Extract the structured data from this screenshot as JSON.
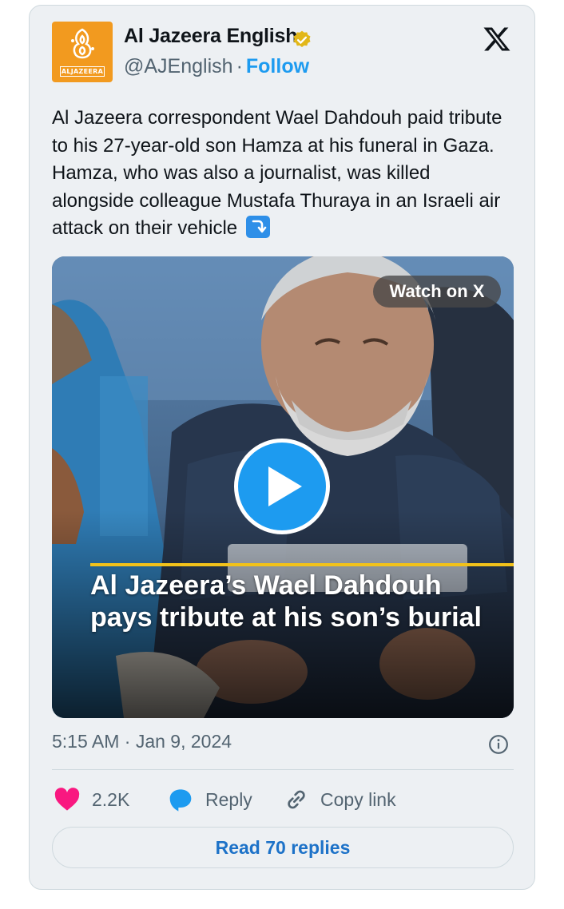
{
  "author": {
    "display_name": "Al Jazeera English",
    "handle": "@AJEnglish",
    "separator": "·",
    "follow_label": "Follow",
    "avatar_text": "ALJAZEERA"
  },
  "tweet": {
    "text": "Al Jazeera correspondent Wael Dahdouh paid tribute to his 27-year-old son Hamza at his funeral in Gaza. Hamza, who was also a journalist, was killed alongside colleague Mustafa Thuraya in an Israeli air attack on their vehicle",
    "emoji_icon": "arrow-down-right-icon"
  },
  "media": {
    "watch_label": "Watch on X",
    "overlay_title": "Al Jazeera’s Wael Dahdouh pays tribute at his son’s burial",
    "play_icon": "play-icon"
  },
  "meta": {
    "timestamp": "5:15 AM · Jan 9, 2024"
  },
  "actions": {
    "like_count": "2.2K",
    "reply_label": "Reply",
    "copy_label": "Copy link"
  },
  "footer": {
    "read_replies_label": "Read 70 replies"
  },
  "colors": {
    "accent": "#1d9bf0",
    "like": "#f91880",
    "brand": "#f29a1f",
    "card_bg": "#edf0f3"
  }
}
